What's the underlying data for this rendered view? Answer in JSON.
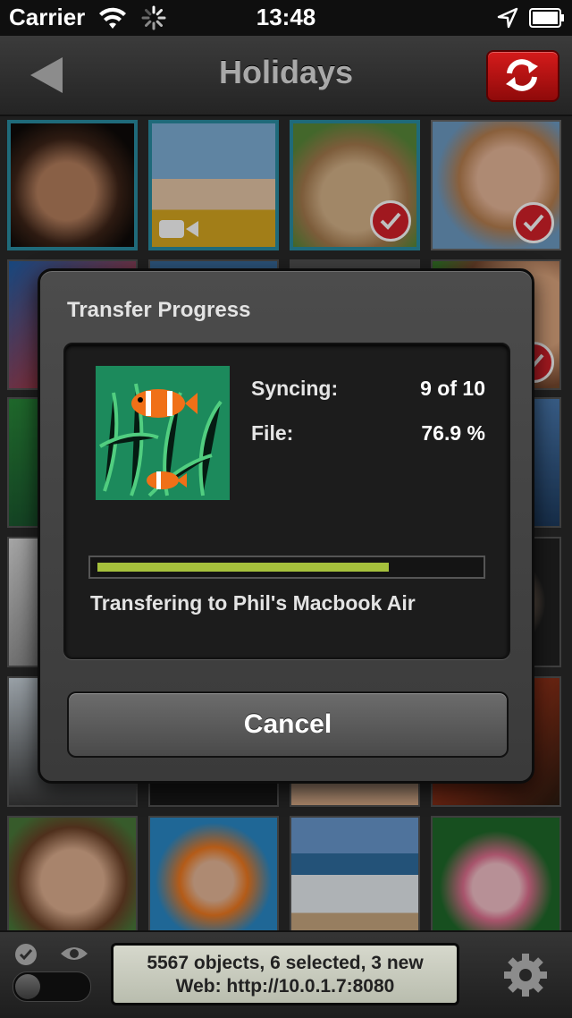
{
  "status_bar": {
    "carrier": "Carrier",
    "time": "13:48"
  },
  "nav": {
    "title": "Holidays"
  },
  "dialog": {
    "title": "Transfer Progress",
    "syncing_label": "Syncing:",
    "syncing_value": "9 of 10",
    "file_label": "File:",
    "file_value": "76.9 %",
    "progress_fraction": 0.769,
    "caption": "Transfering to Phil's Macbook Air",
    "cancel_label": "Cancel"
  },
  "toolbar": {
    "status_line1": "5567 objects, 6 selected, 3 new",
    "status_line2": "Web: http://10.0.1.7:8080"
  },
  "colors": {
    "accent": "#2a8ea3",
    "sync_button": "#c01515",
    "progress": "#a6c13c",
    "check_badge": "#d6212a"
  }
}
